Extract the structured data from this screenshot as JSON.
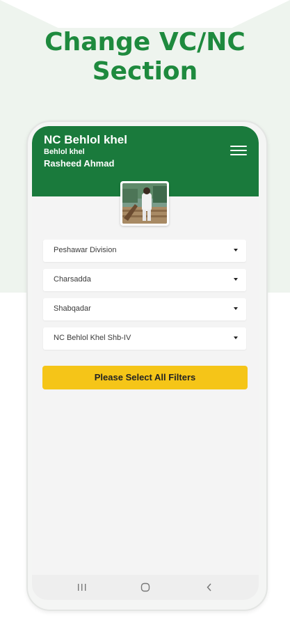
{
  "promo": {
    "headline_line1": "Change VC/NC",
    "headline_line2": "Section"
  },
  "header": {
    "title": "NC Behlol khel",
    "subtitle": "Behlol khel",
    "user_name": "Rasheed Ahmad",
    "menu_icon": "hamburger-menu-icon"
  },
  "profile": {
    "avatar": "profile-photo"
  },
  "filters": [
    {
      "value": "Peshawar Division"
    },
    {
      "value": "Charsadda"
    },
    {
      "value": "Shabqadar"
    },
    {
      "value": "NC Behlol Khel Shb-IV"
    }
  ],
  "action": {
    "label": "Please Select All Filters"
  },
  "navigation": {
    "recents_icon": "recents-icon",
    "home_icon": "home-icon",
    "back_icon": "back-icon"
  },
  "colors": {
    "brand_green": "#1a7a3c",
    "headline_green": "#1e8a3e",
    "button_yellow": "#f5c518"
  }
}
